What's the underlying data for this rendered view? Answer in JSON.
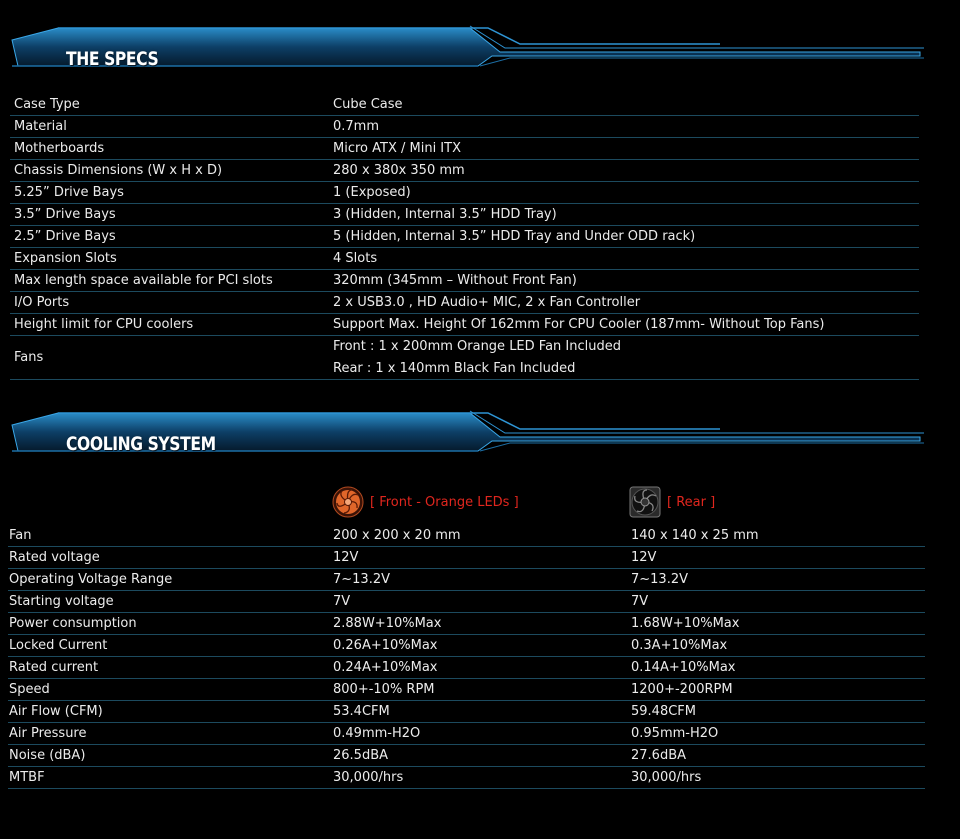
{
  "specs_banner": {
    "title": "THE SPECS"
  },
  "specs": [
    {
      "label": "Case Type",
      "values": [
        "Cube Case"
      ]
    },
    {
      "label": "Material",
      "values": [
        "0.7mm"
      ]
    },
    {
      "label": "Motherboards",
      "values": [
        "Micro ATX / Mini ITX"
      ]
    },
    {
      "label": "Chassis Dimensions (W x H x D)",
      "values": [
        "280 x 380x 350 mm"
      ]
    },
    {
      "label": "5.25” Drive Bays",
      "values": [
        "1 (Exposed)"
      ]
    },
    {
      "label": "3.5” Drive Bays",
      "values": [
        "3 (Hidden, Internal 3.5” HDD Tray)"
      ]
    },
    {
      "label": "2.5” Drive Bays",
      "values": [
        "5 (Hidden, Internal 3.5” HDD Tray and Under ODD rack)"
      ]
    },
    {
      "label": "Expansion Slots",
      "values": [
        "4 Slots"
      ]
    },
    {
      "label": "Max length space available for PCI slots",
      "values": [
        "320mm (345mm – Without Front Fan)"
      ]
    },
    {
      "label": "I/O Ports",
      "values": [
        "2 x USB3.0 , HD Audio+ MIC, 2 x Fan Controller"
      ]
    },
    {
      "label": "Height limit for CPU coolers",
      "values": [
        "Support Max. Height Of 162mm For CPU Cooler (187mm- Without Top Fans)"
      ]
    },
    {
      "label": "Fans",
      "values": [
        "Front : 1 x 200mm Orange LED Fan Included",
        "Rear : 1 x 140mm Black Fan Included"
      ]
    }
  ],
  "cooling_banner": {
    "title": "COOLING SYSTEM"
  },
  "cooling_headers": {
    "front": "[ Front - Orange LEDs ]",
    "rear": "[ Rear ]"
  },
  "cooling": [
    {
      "label": "Fan",
      "front": "200 x 200 x 20 mm",
      "rear": "140 x 140 x 25 mm"
    },
    {
      "label": "Rated voltage",
      "front": "12V",
      "rear": "12V"
    },
    {
      "label": "Operating Voltage Range",
      "front": "7~13.2V",
      "rear": "7~13.2V"
    },
    {
      "label": "Starting voltage",
      "front": "7V",
      "rear": "7V"
    },
    {
      "label": "Power consumption",
      "front": "2.88W+10%Max",
      "rear": "1.68W+10%Max"
    },
    {
      "label": "Locked Current",
      "front": "0.26A+10%Max",
      "rear": "0.3A+10%Max"
    },
    {
      "label": "Rated current",
      "front": "0.24A+10%Max",
      "rear": "0.14A+10%Max"
    },
    {
      "label": "Speed",
      "front": "800+-10% RPM",
      "rear": "1200+-200RPM"
    },
    {
      "label": "Air Flow (CFM)",
      "front": "53.4CFM",
      "rear": "59.48CFM"
    },
    {
      "label": "Air Pressure",
      "front": "0.49mm-H2O",
      "rear": "0.95mm-H2O"
    },
    {
      "label": "Noise (dBA)",
      "front": "26.5dBA",
      "rear": "27.6dBA"
    },
    {
      "label": "MTBF",
      "front": "30,000/hrs",
      "rear": "30,000/hrs"
    }
  ],
  "colors": {
    "accent_blue": "#1e8fd0",
    "header_red": "#e0261e",
    "row_divider": "#1c4a5e"
  }
}
